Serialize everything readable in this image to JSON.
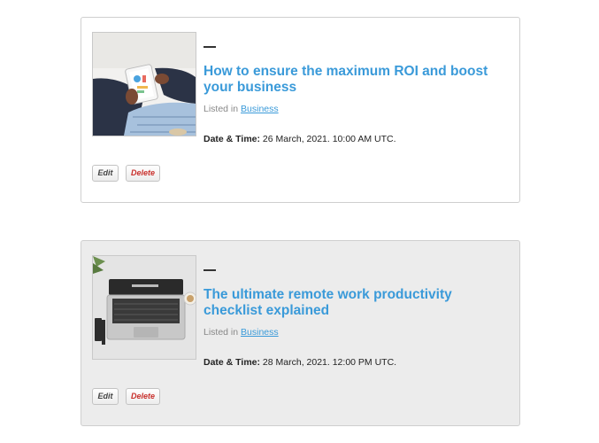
{
  "posts": [
    {
      "image_description": "tablet-chart-photo",
      "title": "How to ensure the maximum ROI and boost your business",
      "listed_prefix": "Listed in",
      "category": "Business",
      "datetime_label": "Date & Time:",
      "datetime_value": "26 March, 2021. 10:00 AM UTC.",
      "edit_label": "Edit",
      "delete_label": "Delete"
    },
    {
      "image_description": "laptop-desk-photo",
      "title": "The ultimate remote work productivity checklist explained",
      "listed_prefix": "Listed in",
      "category": "Business",
      "datetime_label": "Date & Time:",
      "datetime_value": "28 March, 2021. 12:00 PM UTC.",
      "edit_label": "Edit",
      "delete_label": "Delete"
    }
  ],
  "colors": {
    "link": "#3a9ad9",
    "delete": "#c9302c",
    "card_alt_bg": "#ececec"
  }
}
